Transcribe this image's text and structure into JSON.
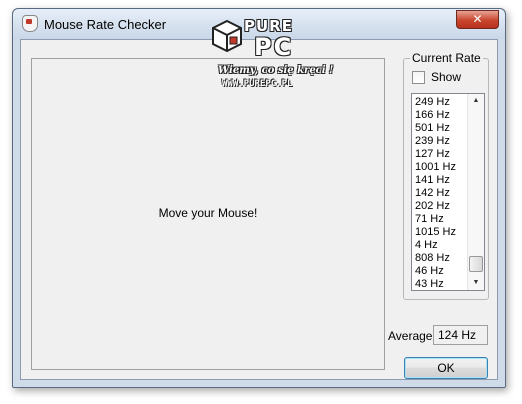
{
  "window": {
    "title": "Mouse Rate Checker",
    "close_glyph": "✕"
  },
  "watermark": {
    "brand_top": "PURE",
    "brand_bottom": "PC",
    "tagline": "Wiemy, co się kręci !",
    "url": "WWW.PUREPC.PL"
  },
  "mouse_area": {
    "prompt": "Move your Mouse!"
  },
  "current_rate": {
    "group_title": "Current Rate",
    "show_label": "Show",
    "show_checked": false,
    "rates": [
      "249 Hz",
      "166 Hz",
      "501 Hz",
      "239 Hz",
      "127 Hz",
      "1001 Hz",
      "141 Hz",
      "142 Hz",
      "202 Hz",
      "71 Hz",
      "1015 Hz",
      "4 Hz",
      "808 Hz",
      "46 Hz",
      "43 Hz"
    ]
  },
  "average": {
    "label": "Average",
    "value": "124 Hz"
  },
  "buttons": {
    "ok_label": "OK"
  },
  "icons": {
    "up": "▲",
    "down": "▼"
  }
}
